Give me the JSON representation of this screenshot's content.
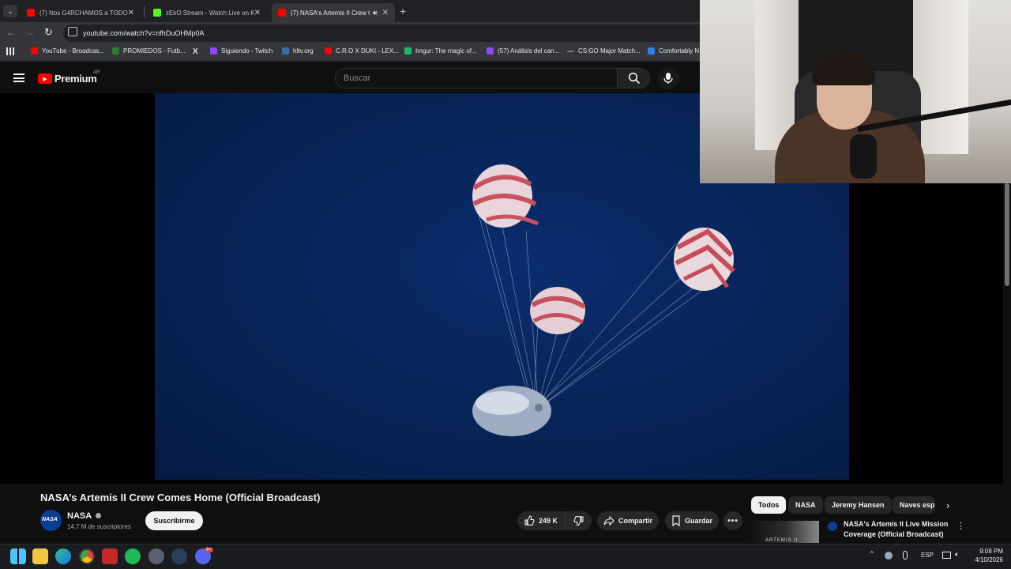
{
  "browser": {
    "tabs": [
      {
        "title": "(7) Nos G4RCHAMOS a TODOS",
        "color": "#ff0000"
      },
      {
        "title": "zEkO Stream - Watch Live on K",
        "color": "#53fc18"
      },
      {
        "title": "(7) NASA's Artemis II Crew Co",
        "color": "#ff0000"
      }
    ],
    "new_tab": "+",
    "url": "youtube.com/watch?v=nfhDuOHMp0A",
    "bookmarks": [
      {
        "label": "YouTube - Broadcas...",
        "color": "#ff0000"
      },
      {
        "label": "PROMIEDOS - Futb...",
        "color": "#2e7d32"
      },
      {
        "label": "X",
        "color": "#ffffff"
      },
      {
        "label": "Siguiendo - Twitch",
        "color": "#9146ff"
      },
      {
        "label": "hltv.org",
        "color": "#3b6ea5"
      },
      {
        "label": "C.R.O X DUKI - LEX...",
        "color": "#ff0000"
      },
      {
        "label": "Imgur: The magic of...",
        "color": "#1bb76e"
      },
      {
        "label": "(57) Análisis del can...",
        "color": "#9146ff"
      },
      {
        "label": "CS:GO Major Match...",
        "color": "#777777"
      },
      {
        "label": "Comfortably N",
        "color": "#2f80ed"
      }
    ]
  },
  "youtube": {
    "logo_text": "Premium",
    "region": "AR",
    "search_placeholder": "Buscar",
    "video_title": "NASA’s Artemis II Crew Comes Home (Official Broadcast)",
    "channel": {
      "name": "NASA",
      "avatar_text": "NASA",
      "subscribers": "14,7 M de suscriptores"
    },
    "subscribe_label": "Suscribirme",
    "likes": "249 K",
    "share_label": "Compartir",
    "save_label": "Guardar",
    "chips": [
      "Todos",
      "NASA",
      "Jeremy Hansen",
      "Naves esp"
    ],
    "recommendation": {
      "title": "NASA's Artemis II Live Mission Coverage (Official Broadcast)",
      "thumb_text": "ARTEMIS II"
    }
  },
  "taskbar": {
    "language": "ESP",
    "time": "9:08 PM",
    "date": "4/10/2026",
    "badge": "9+"
  }
}
